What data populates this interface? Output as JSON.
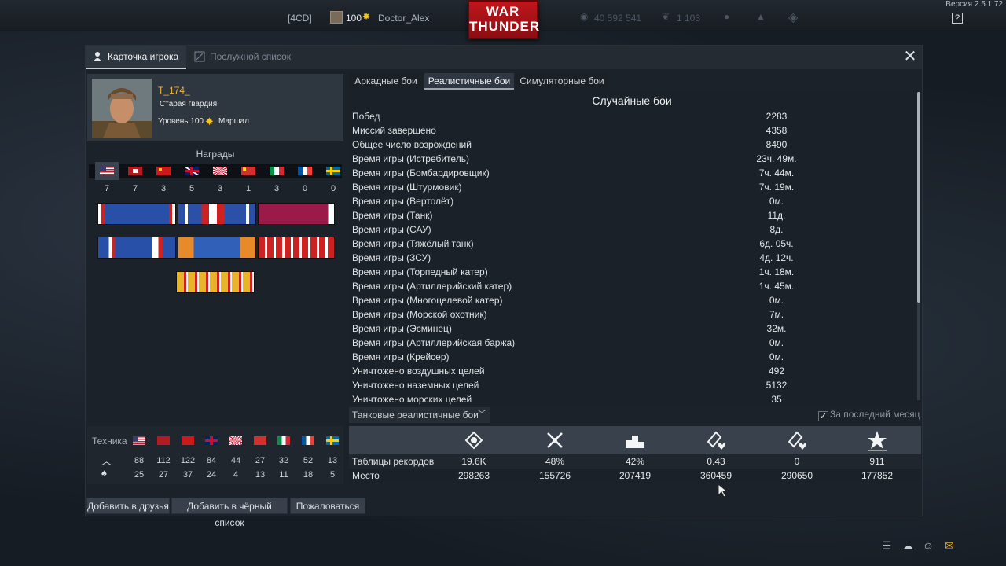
{
  "topbar": {
    "squad_tag": "[4CD]",
    "player_level": "100",
    "player_name": "Doctor_Alex",
    "silver_lions": "40 592 541",
    "golden_eagles": "1 103",
    "logo_line1": "WAR",
    "logo_line2": "THUNDER",
    "version": "Версия 2.5.1.72",
    "help_label": "?"
  },
  "window": {
    "tabs": [
      {
        "label": "Карточка игрока",
        "active": true
      },
      {
        "label": "Послужной список",
        "active": false
      }
    ],
    "close_label": "✕"
  },
  "profile": {
    "nickname": "T_174_",
    "title": "Старая гвардия",
    "level_text": "Уровень 100",
    "rank": "Маршал"
  },
  "awards": {
    "title": "Награды",
    "countries": [
      "usa",
      "germany",
      "ussr",
      "britain",
      "japan",
      "china",
      "italy",
      "france",
      "sweden"
    ],
    "counts": [
      "7",
      "7",
      "3",
      "5",
      "3",
      "1",
      "3",
      "0",
      "0"
    ]
  },
  "technique": {
    "label": "Техника",
    "countries": [
      "usa",
      "germany",
      "ussr",
      "britain",
      "japan",
      "china",
      "italy",
      "france",
      "sweden"
    ],
    "row_up": [
      "88",
      "112",
      "122",
      "84",
      "44",
      "27",
      "32",
      "52",
      "13"
    ],
    "row_down": [
      "25",
      "27",
      "37",
      "24",
      "4",
      "13",
      "11",
      "18",
      "5"
    ]
  },
  "actions": {
    "add_friend": "Добавить в друзья",
    "add_blacklist": "Добавить в чёрный список",
    "report": "Пожаловаться"
  },
  "stat_tabs": [
    {
      "label": "Аркадные бои",
      "active": false
    },
    {
      "label": "Реалистичные бои",
      "active": true
    },
    {
      "label": "Симуляторные бои",
      "active": false
    }
  ],
  "stats": {
    "title": "Случайные бои",
    "rows": [
      {
        "label": "Побед",
        "value": "2283"
      },
      {
        "label": "Миссий завершено",
        "value": "4358"
      },
      {
        "label": "Общее число возрождений",
        "value": "8490"
      },
      {
        "label": "Время игры (Истребитель)",
        "value": "23ч. 49м."
      },
      {
        "label": "Время игры (Бомбардировщик)",
        "value": "7ч. 44м."
      },
      {
        "label": "Время игры (Штурмовик)",
        "value": "7ч. 19м."
      },
      {
        "label": "Время игры (Вертолёт)",
        "value": "0м."
      },
      {
        "label": "Время игры (Танк)",
        "value": "11д."
      },
      {
        "label": "Время игры (САУ)",
        "value": "8д."
      },
      {
        "label": "Время игры (Тяжёлый танк)",
        "value": "6д. 05ч."
      },
      {
        "label": "Время игры (ЗСУ)",
        "value": "4д. 12ч."
      },
      {
        "label": "Время игры (Торпедный катер)",
        "value": "1ч. 18м."
      },
      {
        "label": "Время игры (Артиллерийский катер)",
        "value": "1ч. 45м."
      },
      {
        "label": "Время игры (Многоцелевой катер)",
        "value": "0м."
      },
      {
        "label": "Время игры (Морской охотник)",
        "value": "7м."
      },
      {
        "label": "Время игры (Эсминец)",
        "value": "32м."
      },
      {
        "label": "Время игры (Артиллерийская баржа)",
        "value": "0м."
      },
      {
        "label": "Время игры (Крейсер)",
        "value": "0м."
      },
      {
        "label": "Уничтожено воздушных целей",
        "value": "492"
      },
      {
        "label": "Уничтожено наземных целей",
        "value": "5132"
      },
      {
        "label": "Уничтожено морских целей",
        "value": "35"
      }
    ]
  },
  "records": {
    "mode_select": "Танковые реалистичные бои",
    "last_month_label": "За последний месяц",
    "last_month_checked": true,
    "icons": [
      "efficiency-icon",
      "crossed-swords-icon",
      "podium-icon",
      "kills-per-death-icon",
      "kills-per-spawn-icon",
      "star-icon"
    ],
    "row1_label": "Таблицы рекордов",
    "row1_values": [
      "19.6K",
      "48%",
      "42%",
      "0.43",
      "0",
      "911"
    ],
    "row2_label": "Место",
    "row2_values": [
      "298263",
      "155726",
      "207419",
      "360459",
      "290650",
      "177852"
    ]
  },
  "colors": {
    "accent": "#e8b53e",
    "logo_red": "#c0161c"
  }
}
